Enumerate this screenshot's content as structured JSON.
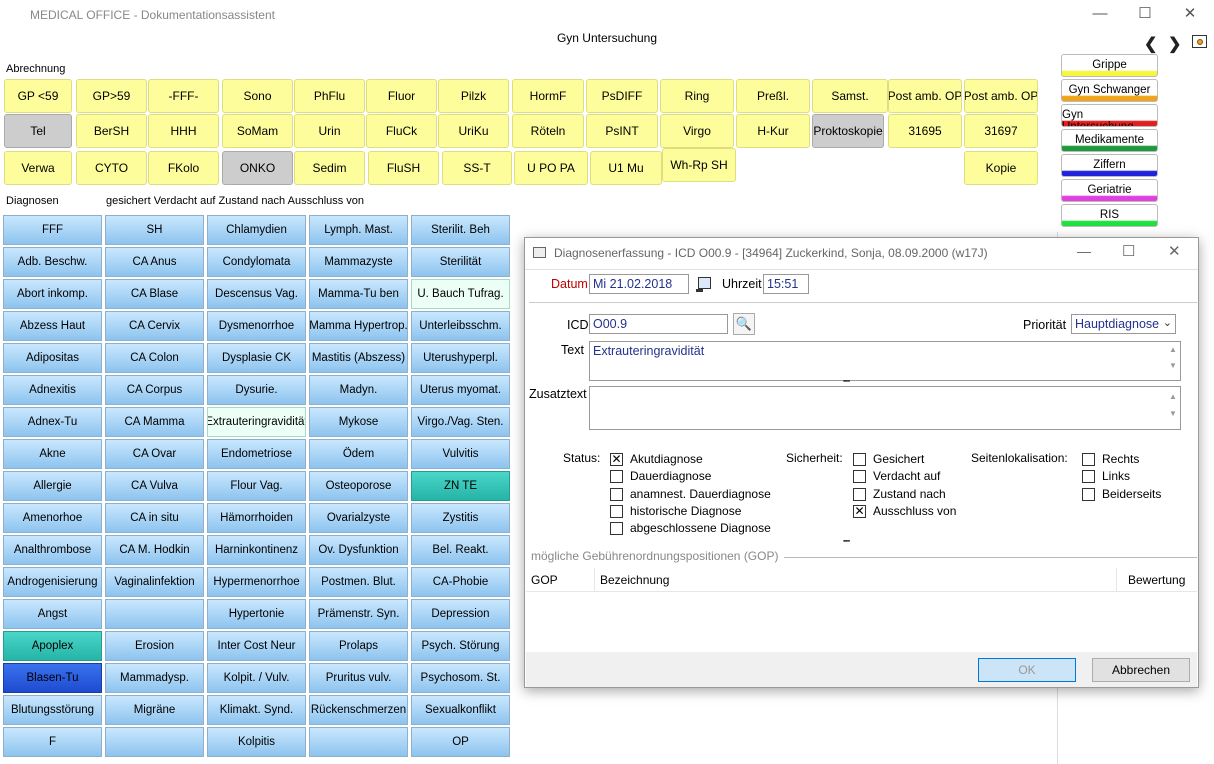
{
  "window": {
    "title": "MEDICAL OFFICE - Dokumentationsassistent",
    "minimize": "—",
    "maximize": "☐",
    "close": "✕"
  },
  "center_title": "Gyn Untersuchung",
  "nav": {
    "back": "❮",
    "forward": "❯"
  },
  "labels": {
    "abrechnung": "Abrechnung",
    "diagnosen": "Diagnosen",
    "sicherheit_row": "gesichert  Verdacht auf  Zustand nach  Ausschluss von"
  },
  "abrechnung_rows": [
    [
      "GP <59",
      "GP>59",
      "-FFF-",
      "Sono",
      "PhFlu",
      "Fluor",
      "Pilzk",
      "HormF",
      "PsDIFF",
      "Ring",
      "Preßl.",
      "Samst.",
      "Post amb. OP",
      "Post amb. OP"
    ],
    [
      "Tel",
      "BerSH",
      "HHH",
      "SoMam",
      "Urin",
      "FluCk",
      "UriKu",
      "Röteln",
      "PsINT",
      "Virgo",
      "H-Kur",
      "Proktoskopie",
      "31695",
      "31697"
    ],
    [
      "Verwa",
      "CYTO",
      "FKolo",
      "ONKO",
      "Sedim",
      "FluSH",
      "SS-T",
      "U PO PA",
      "U1 Mu",
      "Wh-Rp SH",
      "Kopie"
    ]
  ],
  "diagnosen_cols": [
    [
      "FFF",
      "Adb. Beschw.",
      "Abort inkomp.",
      "Abzess Haut",
      "Adipositas",
      "Adnexitis",
      "Adnex-Tu",
      "Akne",
      "Allergie",
      "Amenorhoe",
      "Analthrombose",
      "Androgenisierung",
      "Angst",
      "Apoplex",
      "Blasen-Tu",
      "Blutungsstörung",
      "F"
    ],
    [
      "SH",
      "CA Anus",
      "CA Blase",
      "CA Cervix",
      "CA Colon",
      "CA Corpus",
      "CA Mamma",
      "CA Ovar",
      "CA Vulva",
      "CA in situ",
      "CA M. Hodkin",
      "Vaginalinfektion",
      "",
      "Erosion",
      "Mammadysp.",
      "Migräne",
      ""
    ],
    [
      "Chlamydien",
      "Condylomata",
      "Descensus Vag.",
      "Dysmenorrhoe",
      "Dysplasie CK",
      "Dysurie.",
      "Extrauteringravidität",
      "Endometriose",
      "Flour Vag.",
      "Hämorrhoiden",
      "Harninkontinenz",
      "Hypermenorrhoe",
      "Hypertonie",
      "Inter Cost Neur",
      "Kolpit. / Vulv.",
      "Klimakt. Synd.",
      "Kolpitis"
    ],
    [
      "Lymph. Mast.",
      "Mammazyste",
      "Mamma-Tu ben",
      "Mamma Hypertrop.",
      "Mastitis (Abszess)",
      "Madyn.",
      "Mykose",
      "Ödem",
      "Osteoporose",
      "Ovarialzyste",
      "Ov. Dysfunktion",
      "Postmen. Blut.",
      "Prämenstr. Syn.",
      "Prolaps",
      "Pruritus vulv.",
      "Rückenschmerzen",
      ""
    ],
    [
      "Sterilit. Beh",
      "Sterilität",
      "U. Bauch Tufrag.",
      "Unterleibsschm.",
      "Uterushyperpl.",
      "Uterus myomat.",
      "Virgo./Vag. Sten.",
      "Vulvitis",
      "ZN TE",
      "Zystitis",
      "Bel. Reakt.",
      "CA-Phobie",
      "Depression",
      "Psych. Störung",
      "Psychosom. St.",
      "Sexualkonflikt",
      "OP"
    ]
  ],
  "right_buttons": [
    {
      "label": "Grippe",
      "color": "#f5f542"
    },
    {
      "label": "Gyn Schwanger",
      "color": "#f0a418"
    },
    {
      "label": "Gyn Untersuchung",
      "color": "#e02020"
    },
    {
      "label": "Medikamente",
      "color": "#1e9a3c"
    },
    {
      "label": "Ziffern",
      "color": "#2222dd"
    },
    {
      "label": "Geriatrie",
      "color": "#e040e0"
    },
    {
      "label": "RIS",
      "color": "#20e040"
    }
  ],
  "dialog": {
    "title": "Diagnosenerfassung - ICD O00.9 - [34964] Zuckerkind, Sonja, 08.09.2000 (w17J)",
    "datum_label": "Datum",
    "datum_value": "Mi 21.02.2018",
    "uhrzeit_label": "Uhrzeit",
    "uhrzeit_value": "15:51",
    "icd_label": "ICD",
    "icd_value": "O00.9",
    "prioritaet_label": "Priorität",
    "prioritaet_value": "Hauptdiagnose",
    "text_label": "Text",
    "text_value": "Extrauteringravidität",
    "zusatz_label": "Zusatztext",
    "zusatz_value": "",
    "status_label": "Status:",
    "status": [
      {
        "label": "Akutdiagnose",
        "checked": true
      },
      {
        "label": "Dauerdiagnose",
        "checked": false
      },
      {
        "label": "anamnest. Dauerdiagnose",
        "checked": false
      },
      {
        "label": "historische Diagnose",
        "checked": false
      },
      {
        "label": "abgeschlossene Diagnose",
        "checked": false
      }
    ],
    "sicherheit_label": "Sicherheit:",
    "sicherheit": [
      {
        "label": "Gesichert",
        "checked": false
      },
      {
        "label": "Verdacht auf",
        "checked": false
      },
      {
        "label": "Zustand nach",
        "checked": false
      },
      {
        "label": "Ausschluss von",
        "checked": true
      }
    ],
    "seiten_label": "Seitenlokalisation:",
    "seiten": [
      {
        "label": "Rechts",
        "checked": false
      },
      {
        "label": "Links",
        "checked": false
      },
      {
        "label": "Beiderseits",
        "checked": false
      }
    ],
    "gop_section": "mögliche Gebührenordnungspositionen (GOP)",
    "gop_headers": [
      "GOP",
      "Bezeichnung",
      "Bewertung"
    ],
    "ok": "OK",
    "cancel": "Abbrechen"
  }
}
